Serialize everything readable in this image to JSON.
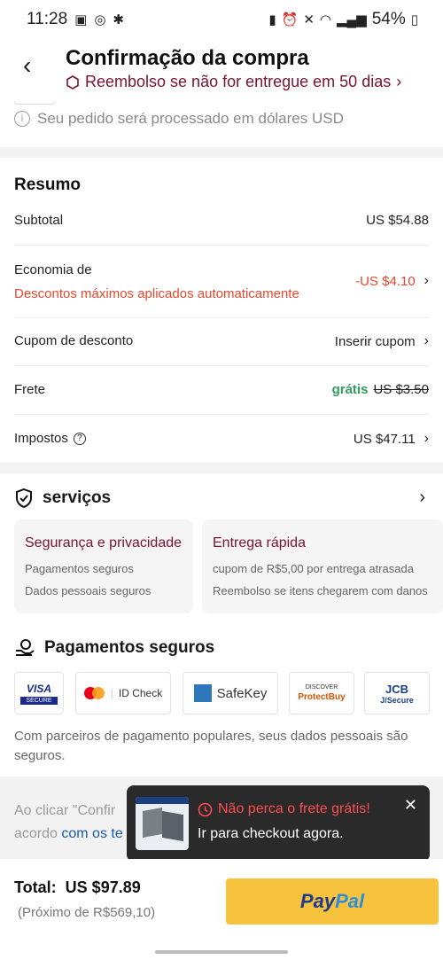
{
  "status_bar": {
    "time": "11:28",
    "battery": "54%"
  },
  "header": {
    "title": "Confirmação da compra",
    "subtitle": "Reembolso se não for entregue em 50 dias"
  },
  "currency_note": "Seu pedido será processado em dólares USD",
  "summary": {
    "title": "Resumo",
    "subtotal_label": "Subtotal",
    "subtotal_value": "US $54.88",
    "savings_label": "Economia de",
    "savings_note": "Descontos máximos aplicados automaticamente",
    "savings_value": "-US $4.10",
    "coupon_label": "Cupom de desconto",
    "coupon_value": "Inserir cupom",
    "shipping_label": "Frete",
    "shipping_free": "grátis",
    "shipping_old": "US $3.50",
    "taxes_label": "Impostos",
    "taxes_value": "US $47.11"
  },
  "services": {
    "title": "serviços",
    "cards": [
      {
        "title": "Segurança e privacidade",
        "lines": [
          "Pagamentos seguros",
          "Dados pessoais seguros"
        ]
      },
      {
        "title": "Entrega rápida",
        "lines": [
          "cupom de R$5,00 por entrega atrasada",
          "Reembolso se itens chegarem com danos"
        ]
      }
    ]
  },
  "payments": {
    "title": "Pagamentos seguros",
    "logos": [
      "VISA",
      "SECURE",
      "ID Check",
      "SafeKey",
      "DISCOVER",
      "ProtectBuy",
      "JCB",
      "J/Secure"
    ],
    "note": "Com parceiros de pagamento populares, seus dados pessoais são seguros."
  },
  "terms": {
    "line1": "Ao clicar \"Confir",
    "line2_prefix": "acordo",
    "line2_link": "com os te"
  },
  "toast": {
    "title": "Não perca o frete grátis!",
    "subtitle": "Ir para checkout agora."
  },
  "footer": {
    "total_label": "Total:",
    "total_value": "US $97.89",
    "approx": "(Próximo de R$569,10)",
    "paypal_a": "Pay",
    "paypal_b": "Pal"
  }
}
